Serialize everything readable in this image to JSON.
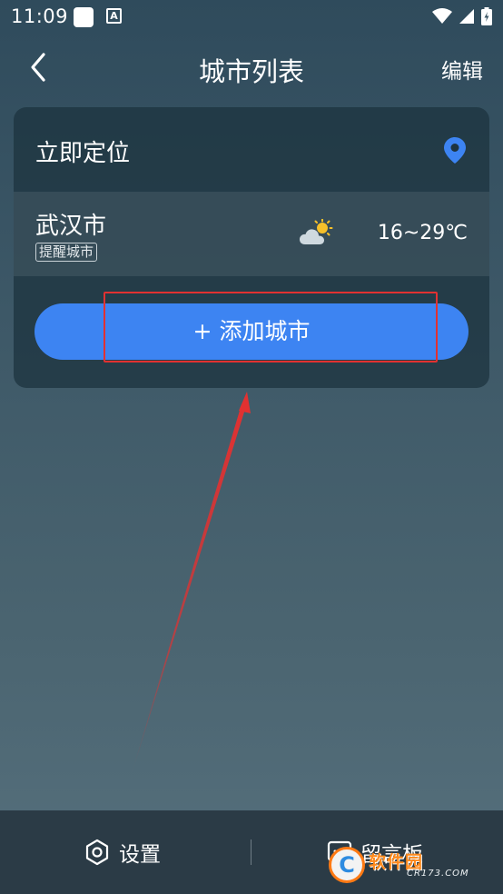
{
  "status_bar": {
    "time": "11:09",
    "notification_letter": "A"
  },
  "header": {
    "title": "城市列表",
    "edit_label": "编辑"
  },
  "locate": {
    "label": "立即定位"
  },
  "city": {
    "name": "武汉市",
    "badge": "提醒城市",
    "temperature": "16~29℃",
    "weather_icon": "partly-cloudy"
  },
  "add_city": {
    "label": "+ 添加城市"
  },
  "bottom_nav": {
    "settings_label": "设置",
    "board_label": "留言板"
  },
  "watermark": {
    "brand": "软件园",
    "logo_letter": "C",
    "sub": "CR173.COM"
  },
  "colors": {
    "accent": "#3d84f2",
    "annotation": "#e23131",
    "bottom_bar": "#2b3b46"
  }
}
